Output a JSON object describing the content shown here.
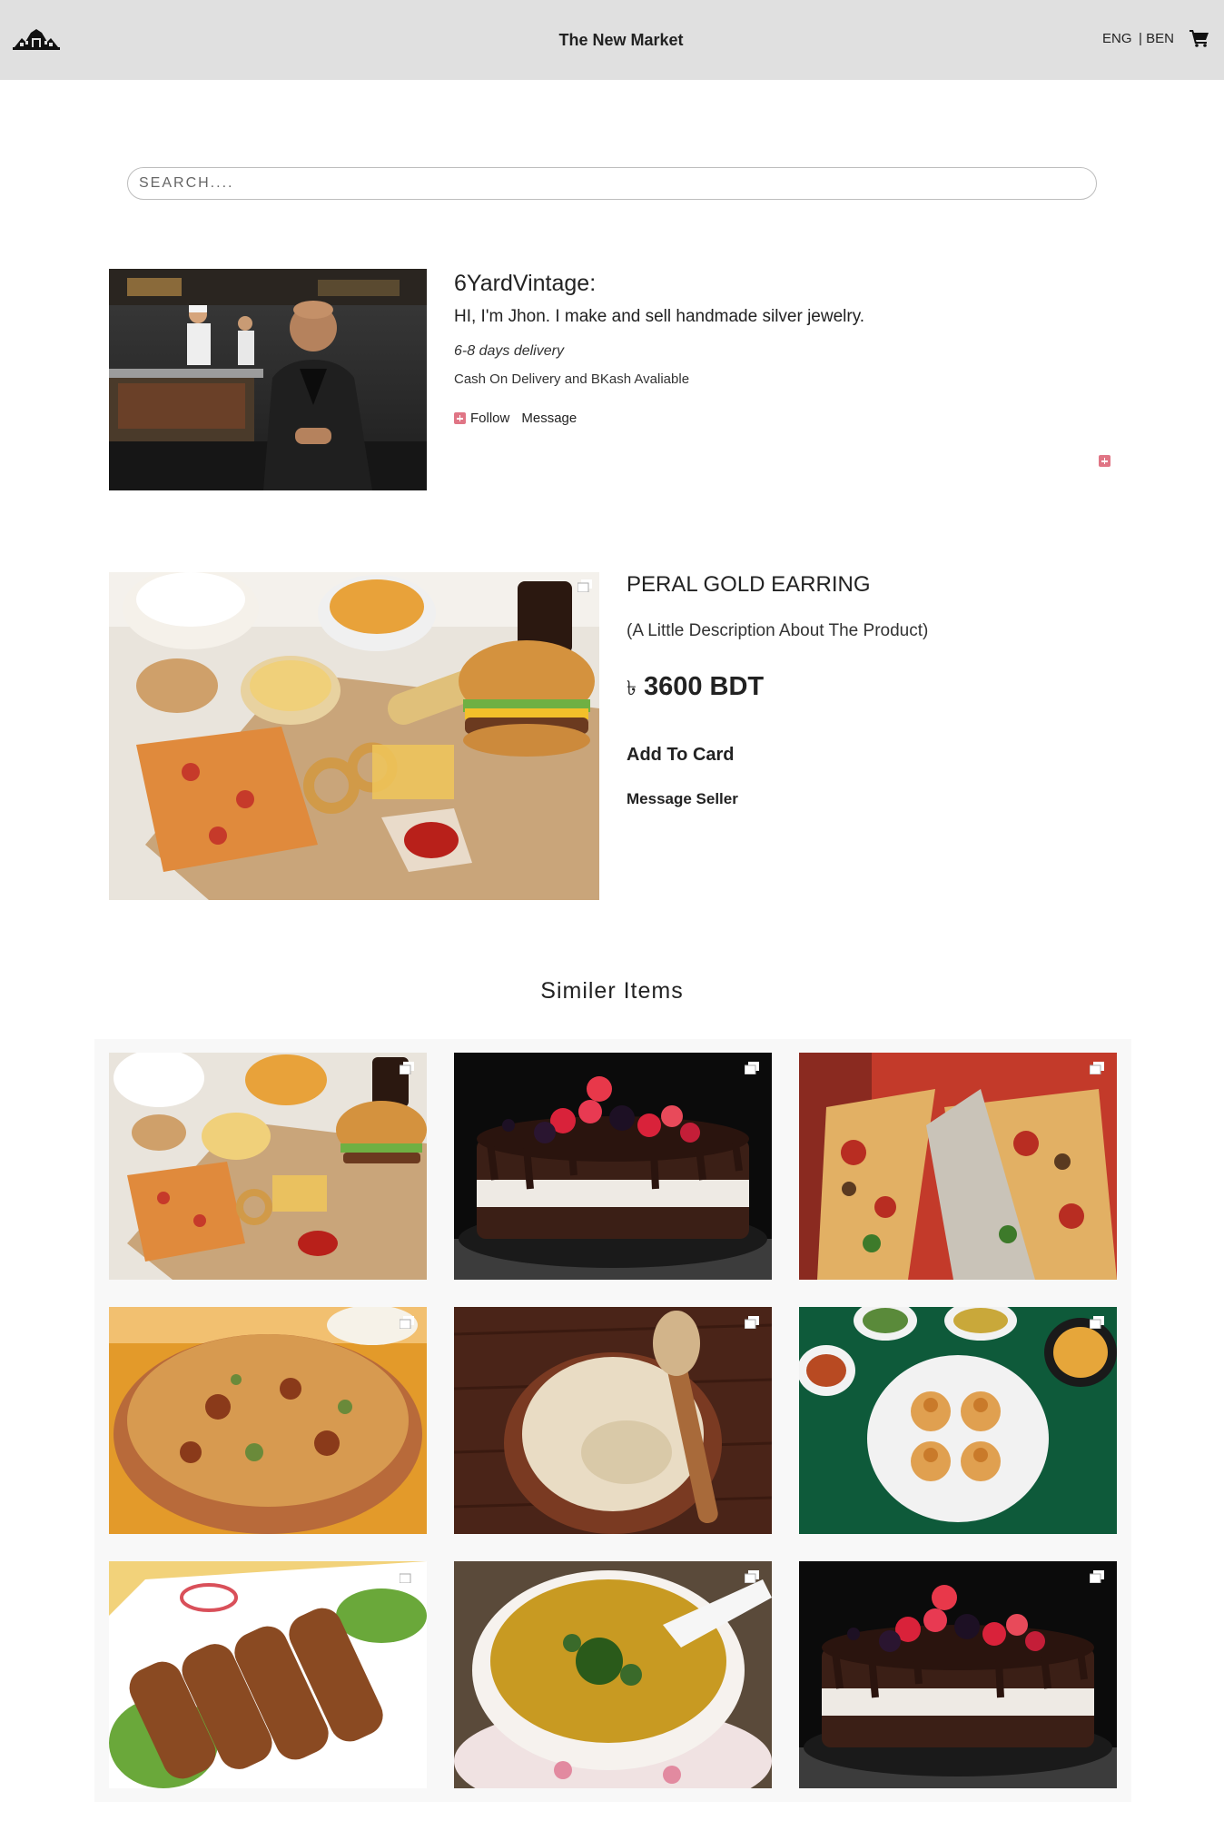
{
  "navbar": {
    "brand": "The New Market",
    "lang_eng": "ENG",
    "lang_ben": "| BEN",
    "logo_icon": "market-building-icon",
    "cart_icon": "shopping-cart-icon",
    "background": "#e0e0e0"
  },
  "search": {
    "placeholder": "SEARCH....",
    "value": ""
  },
  "seller": {
    "name": "6YardVintage:",
    "bio": "HI, I'm Jhon. I make and sell handmade silver jewelry.",
    "delivery": "6-8 days delivery",
    "payment": "Cash On Delivery and BKash Avaliable",
    "follow_label": "Follow",
    "message_label": "Message",
    "accent": "#e07585"
  },
  "product": {
    "title": "PERAL GOLD EARRING",
    "description": "(A Little Description About The Product)",
    "currency_symbol": "৳",
    "price": "3600 BDT",
    "add_to_cart": "Add To Card",
    "message_seller": "Message Seller"
  },
  "similar": {
    "heading": "Similer Items",
    "items": [
      {
        "image": "fast-food-platter"
      },
      {
        "image": "berry-chocolate-cake"
      },
      {
        "image": "pizza-slices"
      },
      {
        "image": "biryani"
      },
      {
        "image": "clay-pot-dessert"
      },
      {
        "image": "pani-puri"
      },
      {
        "image": "seekh-kebab"
      },
      {
        "image": "lentil-soup"
      },
      {
        "image": "berry-chocolate-cake"
      }
    ]
  }
}
